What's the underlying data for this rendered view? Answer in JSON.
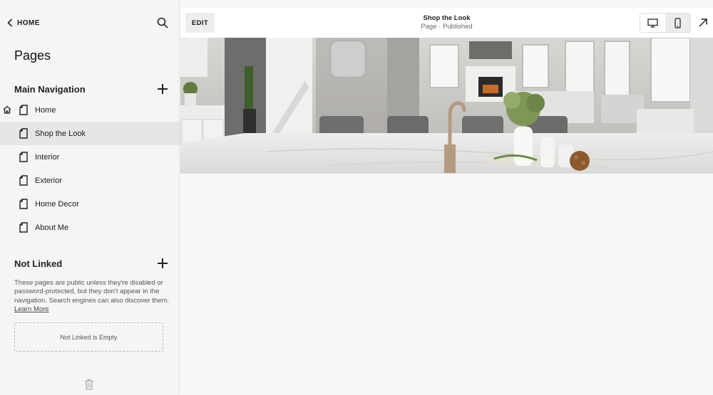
{
  "sidebar": {
    "back_label": "HOME",
    "title": "Pages",
    "main_nav": {
      "title": "Main Navigation",
      "items": [
        {
          "label": "Home",
          "homepage": true
        },
        {
          "label": "Shop the Look",
          "active": true
        },
        {
          "label": "Interior"
        },
        {
          "label": "Exterior"
        },
        {
          "label": "Home Decor"
        },
        {
          "label": "About Me"
        }
      ]
    },
    "not_linked": {
      "title": "Not Linked",
      "description": "These pages are public unless they're disabled or password-protected, but they don't appear in the navigation. Search engines can also discover them.",
      "learn_more": "Learn More",
      "empty_text": "Not Linked is Empty"
    }
  },
  "header": {
    "edit_label": "EDIT",
    "page_title": "Shop the Look",
    "page_status": "Page · Published"
  },
  "colors": {
    "sidebar_bg": "#f5f5f5",
    "active_item_bg": "#e6e6e6",
    "header_bg": "#ffffff"
  },
  "icons": [
    "chevron-left-icon",
    "search-icon",
    "plus-icon",
    "home-icon",
    "page-icon",
    "trash-icon",
    "desktop-icon",
    "mobile-icon",
    "arrow-up-right-icon"
  ]
}
